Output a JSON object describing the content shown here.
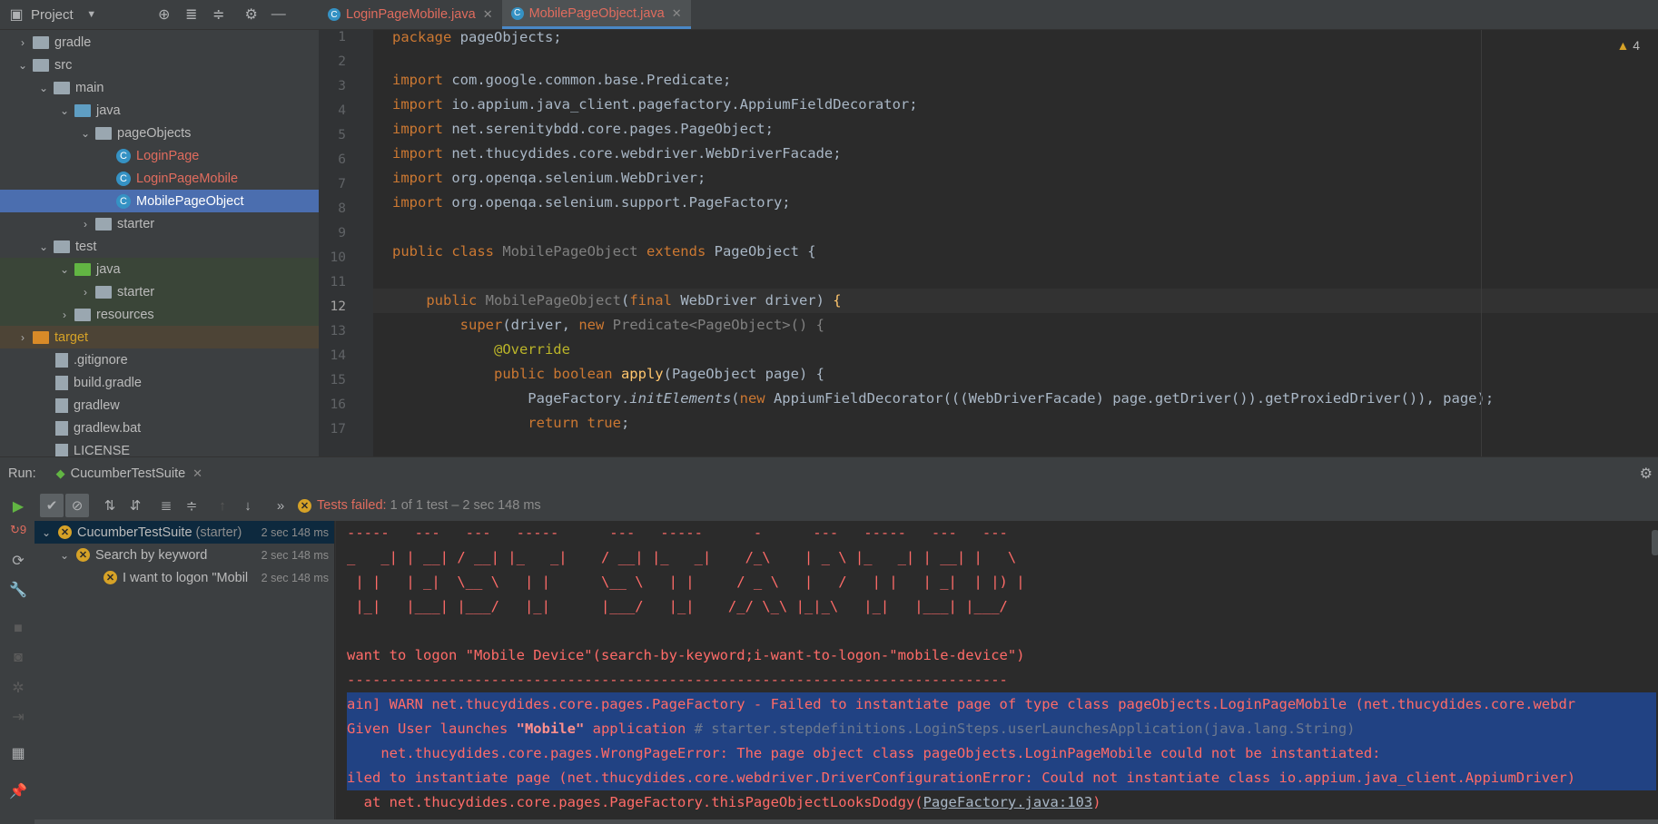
{
  "project_panel": {
    "title": "Project",
    "tree": [
      {
        "label": "gradle",
        "type": "folder",
        "depth": 1,
        "expanded": false
      },
      {
        "label": "src",
        "type": "folder",
        "depth": 1,
        "expanded": true
      },
      {
        "label": "main",
        "type": "folder",
        "depth": 2,
        "expanded": true
      },
      {
        "label": "java",
        "type": "folder-blue",
        "depth": 3,
        "expanded": true
      },
      {
        "label": "pageObjects",
        "type": "package",
        "depth": 4,
        "expanded": true
      },
      {
        "label": "LoginPage",
        "type": "class",
        "depth": 5
      },
      {
        "label": "LoginPageMobile",
        "type": "class",
        "depth": 5
      },
      {
        "label": "MobilePageObject",
        "type": "class",
        "depth": 5
      },
      {
        "label": "starter",
        "type": "package",
        "depth": 4,
        "expanded": false
      },
      {
        "label": "test",
        "type": "folder",
        "depth": 2,
        "expanded": true
      },
      {
        "label": "java",
        "type": "folder-green",
        "depth": 3,
        "expanded": true
      },
      {
        "label": "starter",
        "type": "package",
        "depth": 4,
        "expanded": false
      },
      {
        "label": "resources",
        "type": "resources",
        "depth": 3,
        "expanded": false
      },
      {
        "label": "target",
        "type": "folder-orange",
        "depth": 1,
        "expanded": false
      },
      {
        "label": ".gitignore",
        "type": "file",
        "depth": 2
      },
      {
        "label": "build.gradle",
        "type": "file",
        "depth": 2
      },
      {
        "label": "gradlew",
        "type": "file",
        "depth": 2
      },
      {
        "label": "gradlew.bat",
        "type": "file",
        "depth": 2
      },
      {
        "label": "LICENSE",
        "type": "file",
        "depth": 2
      }
    ]
  },
  "editor": {
    "tabs": [
      {
        "label": "LoginPageMobile.java",
        "active": false
      },
      {
        "label": "MobilePageObject.java",
        "active": true
      }
    ],
    "warnings_count": "4",
    "line_numbers": [
      "1",
      "2",
      "3",
      "4",
      "5",
      "6",
      "7",
      "8",
      "9",
      "10",
      "11",
      "12",
      "13",
      "14",
      "15",
      "16",
      "17"
    ],
    "lines": {
      "l1_kw": "package",
      "l1_rest": " pageObjects;",
      "l3_kw": "import",
      "l3_rest": " com.google.common.base.Predicate;",
      "l4_kw": "import",
      "l4_rest": " io.appium.java_client.pagefactory.AppiumFieldDecorator;",
      "l5_kw": "import",
      "l5_rest": " net.serenitybdd.core.pages.PageObject;",
      "l6_kw": "import",
      "l6_rest": " net.thucydides.core.webdriver.WebDriverFacade;",
      "l7_kw": "import",
      "l7_rest": " org.openqa.selenium.WebDriver;",
      "l8_kw": "import",
      "l8_rest": " org.openqa.selenium.support.PageFactory;",
      "l10_kw": "public class",
      "l10_name": " MobilePageObject",
      "l10_kw2": " extends",
      "l10_rest": " PageObject {",
      "l12_kw": "    public",
      "l12_name": " MobilePageObject",
      "l12_p": "(",
      "l12_kw2": "final",
      "l12_rest": " WebDriver driver) ",
      "l12_brace": "{",
      "l13_kw": "        super",
      "l13_a": "(driver, ",
      "l13_kw2": "new",
      "l13_b": " Predicate<PageObject>() {",
      "l14_an": "            @Override",
      "l15_kw": "            public boolean",
      "l15_fn": " apply",
      "l15_rest": "(PageObject page) {",
      "l16_a": "                PageFactory.",
      "l16_it": "initElements",
      "l16_b": "(",
      "l16_kw": "new",
      "l16_c": " AppiumFieldDecorator(((WebDriverFacade) page.getDriver()).getProxiedDriver()), page);",
      "l17_kw": "                return true",
      "l17_rest": ";"
    }
  },
  "run_panel": {
    "label": "Run:",
    "config_name": "CucumberTestSuite",
    "status": {
      "failed_label": "Tests failed:",
      "summary": " 1 of 1 test – 2 sec 148 ms"
    },
    "tests": [
      {
        "name": "CucumberTestSuite",
        "suffix": " (starter)",
        "time": "2 sec 148 ms"
      },
      {
        "name": "Search by keyword",
        "suffix": "",
        "time": "2 sec 148 ms"
      },
      {
        "name": "I want to logon \"Mobil",
        "suffix": "",
        "time": "2 sec 148 ms"
      }
    ],
    "console": {
      "ascii1": "-----   ---   ---   -----      ---   -----      -      ---   -----   ---   ---",
      "ascii2": "_   _| | __| / __| |_   _|    / __| |_   _|    /_\\    | _ \\ |_   _| | __| |   \\",
      "ascii3": " | |   | _|  \\__ \\   | |      \\__ \\   | |     / _ \\   |   /   | |   | _|  | |) |",
      "ascii4": " |_|   |___| |___/   |_|      |___/   |_|    /_/ \\_\\ |_|_\\   |_|   |___| |___/",
      "scenario": "want to logon \"Mobile Device\"(search-by-keyword;i-want-to-logon-\"mobile-device\")",
      "divider": "------------------------------------------------------------------------------",
      "warn_line": "ain] WARN net.thucydides.core.pages.PageFactory - Failed to instantiate page of type class pageObjects.LoginPageMobile (net.thucydides.core.webdr",
      "given_a": "Given User launches ",
      "given_b": "\"Mobile\"",
      "given_c": " application ",
      "given_comment": "# starter.stepdefinitions.LoginSteps.userLaunchesApplication(java.lang.String)",
      "error_line": "    net.thucydides.core.pages.WrongPageError: The page object class pageObjects.LoginPageMobile could not be instantiated:",
      "failed_line": "iled to instantiate page (net.thucydides.core.webdriver.DriverConfigurationError: Could not instantiate class io.appium.java_client.AppiumDriver)",
      "at_a": "  at net.thucydides.core.pages.PageFactory.thisPageObjectLooksDodgy(",
      "at_link": "PageFactory.java:103",
      "at_b": ")"
    }
  }
}
